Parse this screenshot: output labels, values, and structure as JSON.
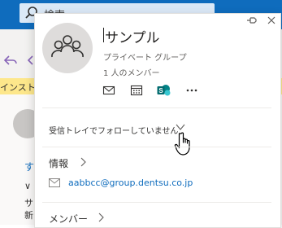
{
  "background": {
    "search_text": "検索",
    "install_text": "インストール",
    "side_text_1": "す",
    "side_text_2": "∨ 今",
    "side_text_3": "サ",
    "side_text_4": "新"
  },
  "card": {
    "group_name": "サンプル",
    "group_type": "プライベート グループ",
    "member_count": "1 人のメンバー",
    "actions": [
      "mail-icon",
      "calendar-icon",
      "sharepoint-icon",
      "more-icon"
    ],
    "follow_status": "受信トレイでフォローしていません",
    "info_label": "情報",
    "email": "aabbcc@group.dentsu.co.jp",
    "members_label": "メンバー"
  },
  "colors": {
    "brand_blue": "#0f6cbd",
    "install_bar": "#fde78b"
  }
}
